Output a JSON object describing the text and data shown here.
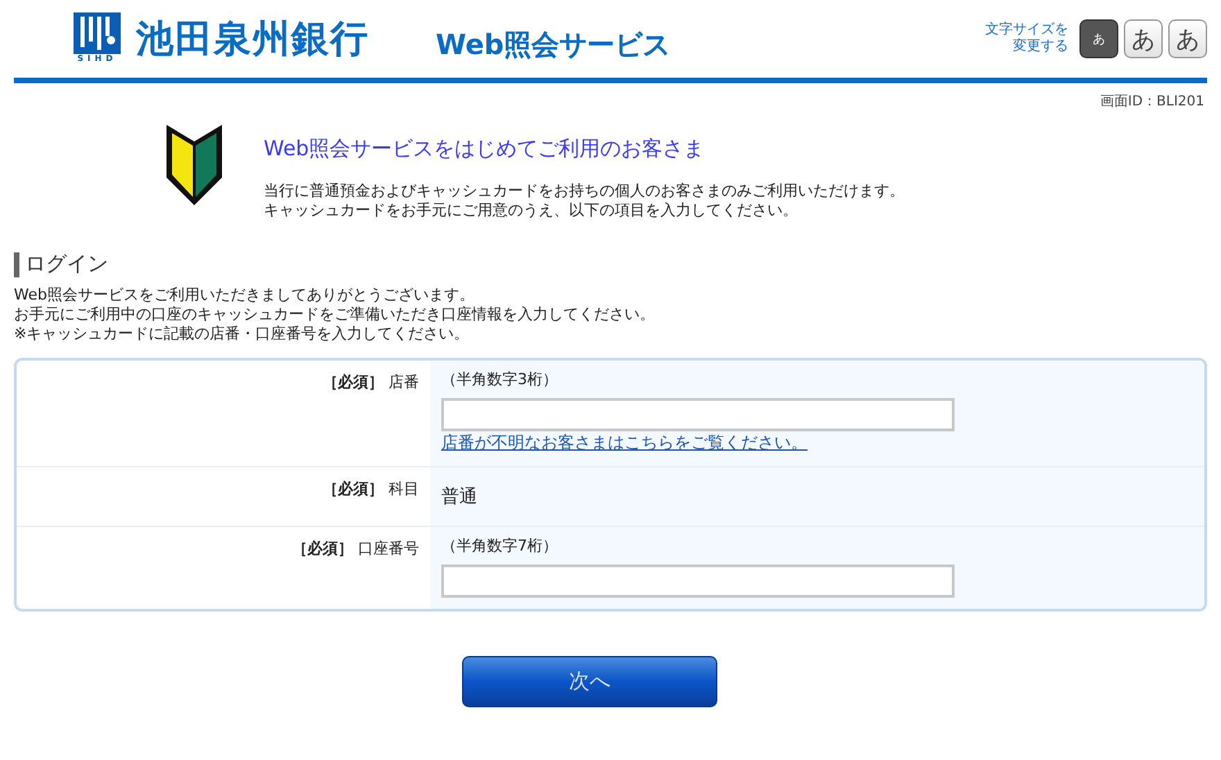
{
  "header": {
    "bank_name": "池田泉州銀行",
    "logo_caption": "SIHD",
    "service_title": "Web照会サービス",
    "font_size_label": [
      "文字サイズを",
      "変更する"
    ],
    "font_size_buttons": [
      {
        "label": "あ",
        "selected": true
      },
      {
        "label": "あ",
        "selected": false
      },
      {
        "label": "あ",
        "selected": false
      }
    ]
  },
  "screen_id": "画面ID：BLI201",
  "intro": {
    "title": "Web照会サービスをはじめてご利用のお客さま",
    "text": [
      "当行に普通預金およびキャッシュカードをお持ちの個人のお客さまのみご利用いただけます。",
      "キャッシュカードをお手元にご用意のうえ、以下の項目を入力してください。"
    ]
  },
  "section": {
    "title": "ログイン",
    "lines": [
      "Web照会サービスをご利用いただきましてありがとうございます。",
      "お手元にご利用中の口座のキャッシュカードをご準備いただき口座情報を入力してください。",
      "※キャッシュカードに記載の店番・口座番号を入力してください。"
    ]
  },
  "form": [
    {
      "kind": "input",
      "required": "［必須］",
      "label": "店番",
      "hint": "（半角数字3桁）",
      "link": "店番が不明なお客さまはこちらをご覧ください。"
    },
    {
      "kind": "text",
      "required": "［必須］",
      "label": "科目",
      "value": "普通"
    },
    {
      "kind": "input",
      "required": "［必須］",
      "label": "口座番号",
      "hint": "（半角数字7桁）"
    }
  ],
  "next_button": "次へ"
}
